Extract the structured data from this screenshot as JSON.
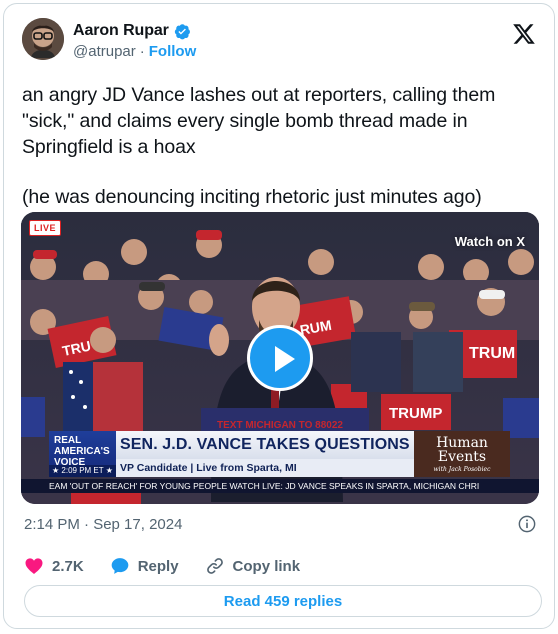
{
  "author": {
    "name": "Aaron Rupar",
    "handle": "@atrupar",
    "separator": "·",
    "follow_label": "Follow"
  },
  "tweet": {
    "paragraph1": "an angry JD Vance lashes out at reporters, calling them \"sick,\" and claims every single bomb thread made in Springfield is a hoax",
    "paragraph2": "(he was denouncing inciting rhetoric just minutes ago)",
    "timestamp": "2:14 PM · Sep 17, 2024"
  },
  "media": {
    "live_badge": "LIVE",
    "watch_label": "Watch on X",
    "chyron_logo": "REAL AMERICA'S VOICE",
    "chyron_headline": "SEN. J.D. VANCE TAKES QUESTIONS",
    "chyron_sub": "VP Candidate | Live from Sparta, MI",
    "chyron_time": "★ 2:09 PM ET ★",
    "brand_logo": "Human Events",
    "brand_tagline": "with Jack Posobiec",
    "ticker": "EAM 'OUT OF REACH' FOR YOUNG PEOPLE      WATCH LIVE: JD VANCE SPEAKS IN SPARTA, MICHIGAN      CHRI",
    "sign_text": "TRUMP"
  },
  "actions": {
    "likes": "2.7K",
    "reply_label": "Reply",
    "copy_label": "Copy link",
    "read_replies": "Read 459 replies"
  },
  "colors": {
    "accent": "#1d9bf0",
    "like": "#f91880",
    "text": "#0f1419",
    "muted": "#536471"
  },
  "icons": [
    "verified-icon",
    "x-logo-icon",
    "play-icon",
    "info-icon",
    "heart-icon",
    "reply-icon",
    "link-icon"
  ]
}
